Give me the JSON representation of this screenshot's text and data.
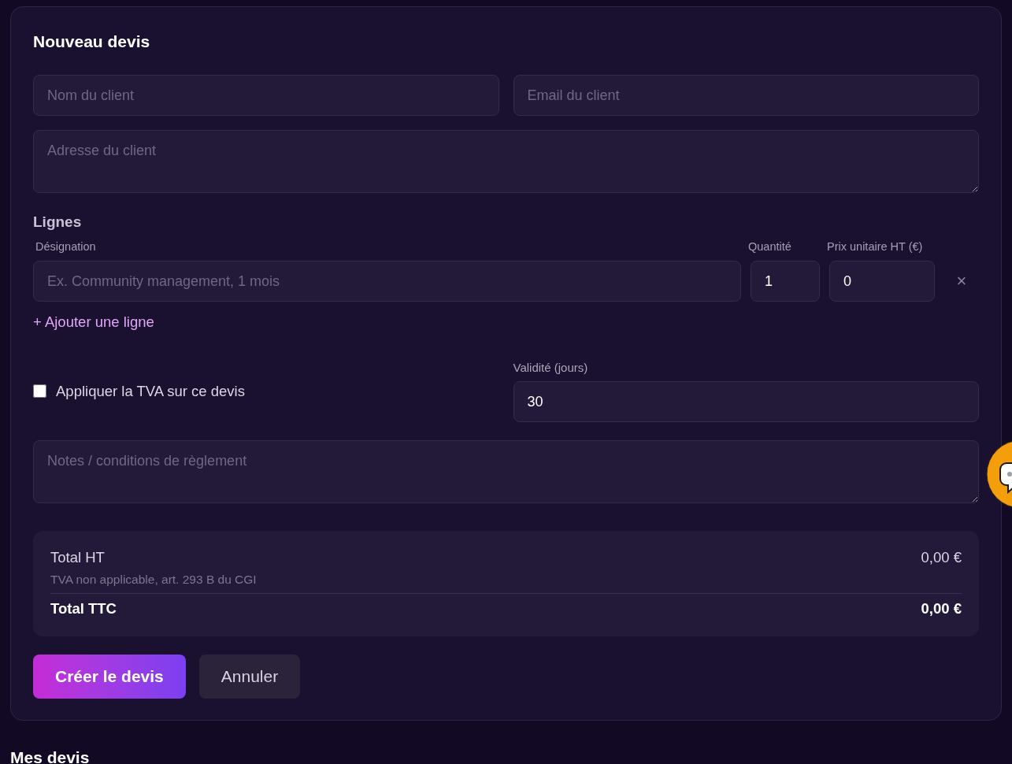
{
  "form": {
    "title": "Nouveau devis",
    "client_fields": [
      {
        "kind": "input",
        "placeholder": "Nom du client"
      },
      {
        "kind": "input",
        "placeholder": "Email du client"
      },
      {
        "kind": "textarea",
        "placeholder": "Adresse du client"
      }
    ],
    "lines_section": {
      "title": "Lignes",
      "columns": [
        "Désignation",
        "Quantité",
        "Prix unitaire HT (€)"
      ],
      "rows": [
        {
          "designation": {
            "placeholder": "Ex. Community management, 1 mois"
          },
          "quantity": "1",
          "unit_price": "0",
          "remove": "×"
        }
      ],
      "add_link": "+ Ajouter une ligne"
    },
    "vat": {
      "label": "Appliquer la TVA sur ce devis",
      "checked": false
    },
    "validity": {
      "label": "Validité (jours)",
      "value": "30"
    },
    "notes": {
      "placeholder": "Notes / conditions de règlement"
    },
    "totals": {
      "subtotal_label": "Total HT",
      "subtotal_value": "0,00 €",
      "vat_note": "TVA non applicable, art. 293 B du CGI",
      "total_label": "Total TTC",
      "total_value": "0,00 €"
    },
    "buttons": [
      {
        "label": "Créer le devis",
        "kind": "primary"
      },
      {
        "label": "Annuler",
        "kind": "secondary"
      }
    ]
  },
  "list_heading": "Mes devis"
}
